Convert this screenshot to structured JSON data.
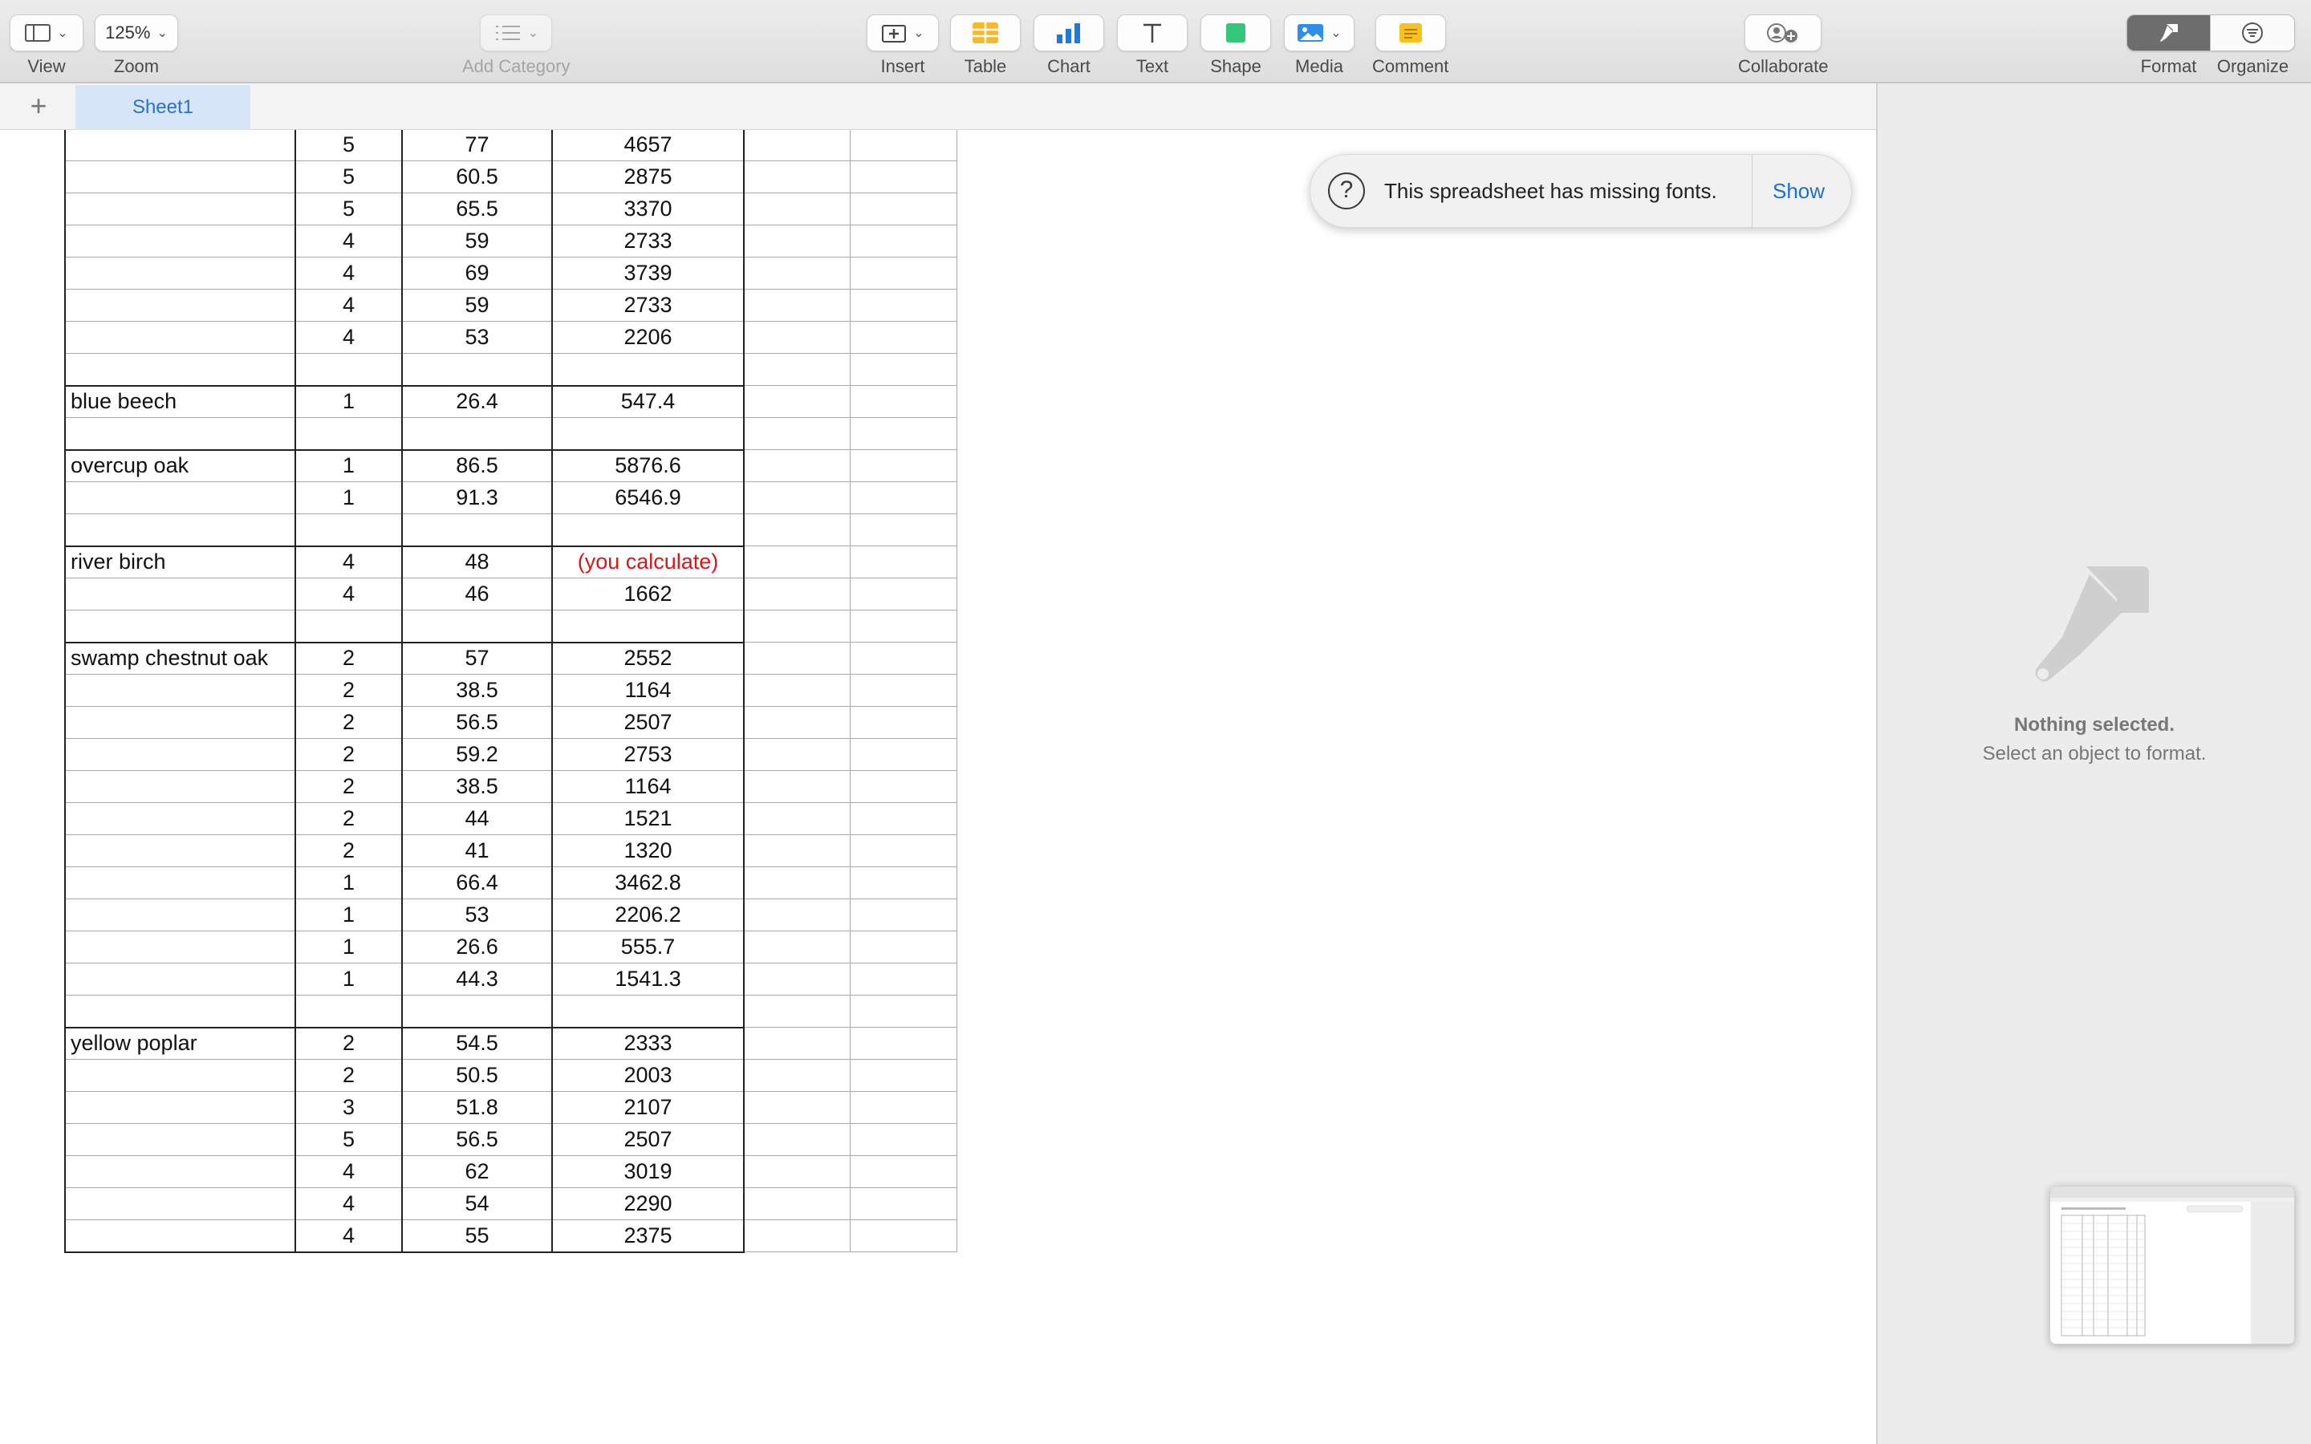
{
  "toolbar": {
    "view_label": "View",
    "zoom_value": "125%",
    "zoom_label": "Zoom",
    "add_category_label": "Add Category",
    "insert_label": "Insert",
    "table_label": "Table",
    "chart_label": "Chart",
    "text_label": "Text",
    "shape_label": "Shape",
    "media_label": "Media",
    "comment_label": "Comment",
    "collaborate_label": "Collaborate",
    "format_label": "Format",
    "organize_label": "Organize"
  },
  "tabs": {
    "sheet1": "Sheet1"
  },
  "banner": {
    "message": "This spreadsheet has missing fonts.",
    "show": "Show"
  },
  "panel": {
    "title": "Nothing selected.",
    "subtitle": "Select an object to format."
  },
  "table": {
    "rows": [
      [
        "",
        "5",
        "77",
        "4657"
      ],
      [
        "",
        "5",
        "60.5",
        "2875"
      ],
      [
        "",
        "5",
        "65.5",
        "3370"
      ],
      [
        "",
        "4",
        "59",
        "2733"
      ],
      [
        "",
        "4",
        "69",
        "3739"
      ],
      [
        "",
        "4",
        "59",
        "2733"
      ],
      [
        "",
        "4",
        "53",
        "2206"
      ],
      [
        "",
        "",
        "",
        ""
      ],
      [
        "blue beech",
        "1",
        "26.4",
        "547.4"
      ],
      [
        "",
        "",
        "",
        ""
      ],
      [
        "overcup oak",
        "1",
        "86.5",
        "5876.6"
      ],
      [
        "",
        "1",
        "91.3",
        "6546.9"
      ],
      [
        "",
        "",
        "",
        ""
      ],
      [
        "river birch",
        "4",
        "48",
        "(you calculate)"
      ],
      [
        "",
        "4",
        "46",
        "1662"
      ],
      [
        "",
        "",
        "",
        ""
      ],
      [
        "swamp chestnut oak",
        "2",
        "57",
        "2552"
      ],
      [
        "",
        "2",
        "38.5",
        "1164"
      ],
      [
        "",
        "2",
        "56.5",
        "2507"
      ],
      [
        "",
        "2",
        "59.2",
        "2753"
      ],
      [
        "",
        "2",
        "38.5",
        "1164"
      ],
      [
        "",
        "2",
        "44",
        "1521"
      ],
      [
        "",
        "2",
        "41",
        "1320"
      ],
      [
        "",
        "1",
        "66.4",
        "3462.8"
      ],
      [
        "",
        "1",
        "53",
        "2206.2"
      ],
      [
        "",
        "1",
        "26.6",
        "555.7"
      ],
      [
        "",
        "1",
        "44.3",
        "1541.3"
      ],
      [
        "",
        "",
        "",
        ""
      ],
      [
        "yellow poplar",
        "2",
        "54.5",
        "2333"
      ],
      [
        "",
        "2",
        "50.5",
        "2003"
      ],
      [
        "",
        "3",
        "51.8",
        "2107"
      ],
      [
        "",
        "5",
        "56.5",
        "2507"
      ],
      [
        "",
        "4",
        "62",
        "3019"
      ],
      [
        "",
        "4",
        "54",
        "2290"
      ],
      [
        "",
        "4",
        "55",
        "2375"
      ]
    ]
  },
  "colors": {
    "accent": "#1e6fd0",
    "tab_bg": "#d6e6f8",
    "warning_text": "#d81818"
  }
}
